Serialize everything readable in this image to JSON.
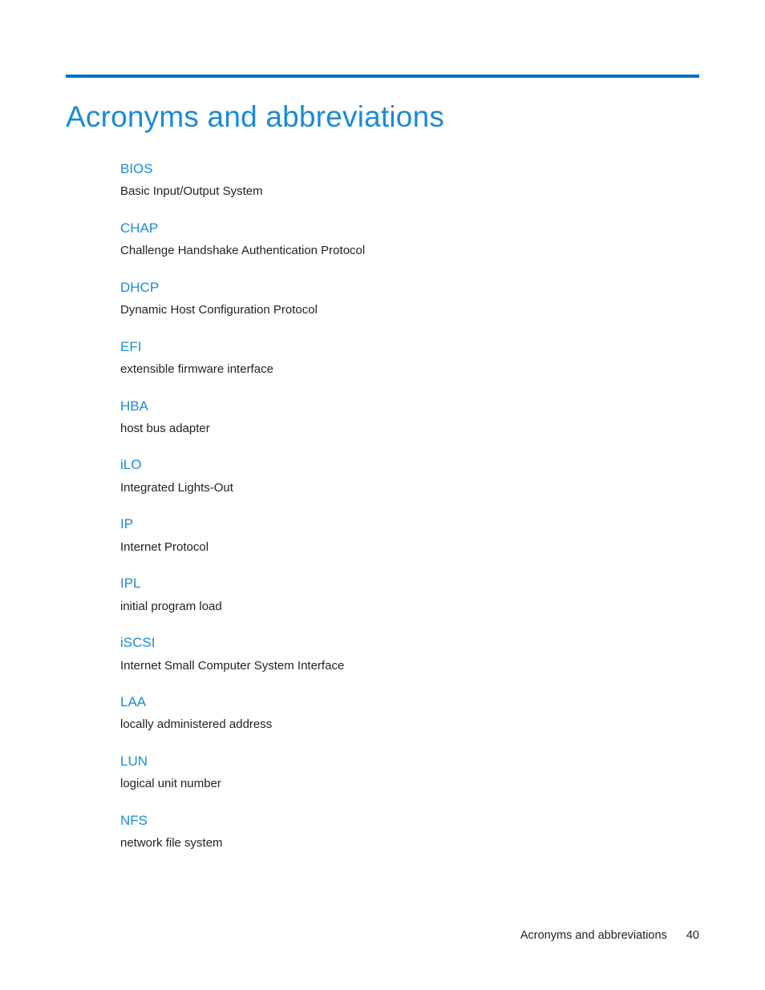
{
  "document": {
    "title": "Acronyms and abbreviations",
    "accent_color": "#1a8bd6",
    "rule_color": "#0071c5",
    "body_color": "#231f20"
  },
  "glossary": [
    {
      "term": "BIOS",
      "definition": "Basic Input/Output System"
    },
    {
      "term": "CHAP",
      "definition": "Challenge Handshake Authentication Protocol"
    },
    {
      "term": "DHCP",
      "definition": "Dynamic Host Configuration Protocol"
    },
    {
      "term": "EFI",
      "definition": "extensible firmware interface"
    },
    {
      "term": "HBA",
      "definition": "host bus adapter"
    },
    {
      "term": "iLO",
      "definition": "Integrated Lights-Out"
    },
    {
      "term": "IP",
      "definition": "Internet Protocol"
    },
    {
      "term": "IPL",
      "definition": "initial program load"
    },
    {
      "term": "iSCSI",
      "definition": "Internet Small Computer System Interface"
    },
    {
      "term": "LAA",
      "definition": "locally administered address"
    },
    {
      "term": "LUN",
      "definition": "logical unit number"
    },
    {
      "term": "NFS",
      "definition": "network file system"
    }
  ],
  "footer": {
    "label": "Acronyms and abbreviations",
    "page_number": "40"
  }
}
